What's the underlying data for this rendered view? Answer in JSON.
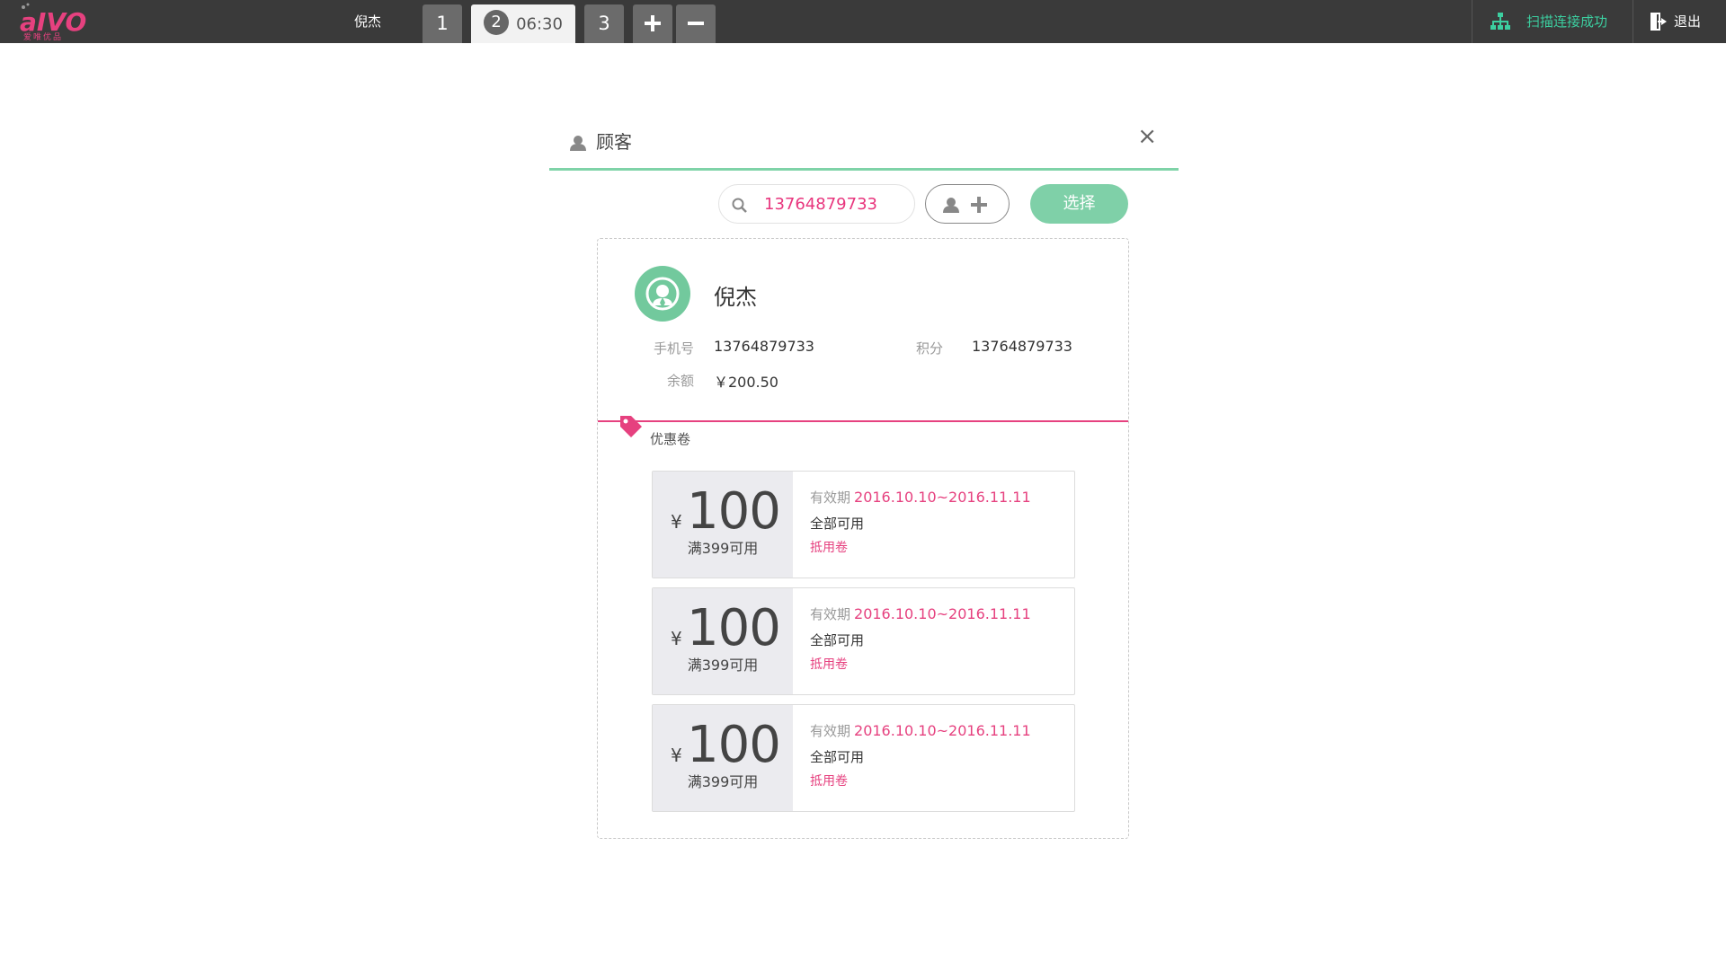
{
  "topbar": {
    "logo_text": "aIVO",
    "logo_subtext": "爱唯优品",
    "operator_name": "倪杰",
    "tabs": [
      {
        "label": "1"
      },
      {
        "label": "2",
        "time": "06:30"
      },
      {
        "label": "3"
      }
    ],
    "scan_status": "扫描连接成功",
    "logout_label": "退出"
  },
  "modal": {
    "title": "顾客",
    "close_label": "×",
    "search_value": "13764879733",
    "select_label": "选择"
  },
  "customer": {
    "name": "倪杰",
    "phone_label": "手机号",
    "phone": "13764879733",
    "points_label": "积分",
    "points": "13764879733",
    "balance_label": "余额",
    "balance": "￥200.50"
  },
  "coupons_label": "优惠卷",
  "coupons": [
    {
      "currency": "¥",
      "amount": "100",
      "condition": "满399可用",
      "validity_label": "有效期",
      "validity": "2016.10.10~2016.11.11",
      "scope": "全部可用",
      "type": "抵用卷"
    },
    {
      "currency": "¥",
      "amount": "100",
      "condition": "满399可用",
      "validity_label": "有效期",
      "validity": "2016.10.10~2016.11.11",
      "scope": "全部可用",
      "type": "抵用卷"
    },
    {
      "currency": "¥",
      "amount": "100",
      "condition": "满399可用",
      "validity_label": "有效期",
      "validity": "2016.10.10~2016.11.11",
      "scope": "全部可用",
      "type": "抵用卷"
    }
  ],
  "colors": {
    "topbar": "#3a3a3a",
    "accent_green": "#7fd0a8",
    "accent_pink": "#e6417f",
    "status_green": "#3ccfa0"
  }
}
